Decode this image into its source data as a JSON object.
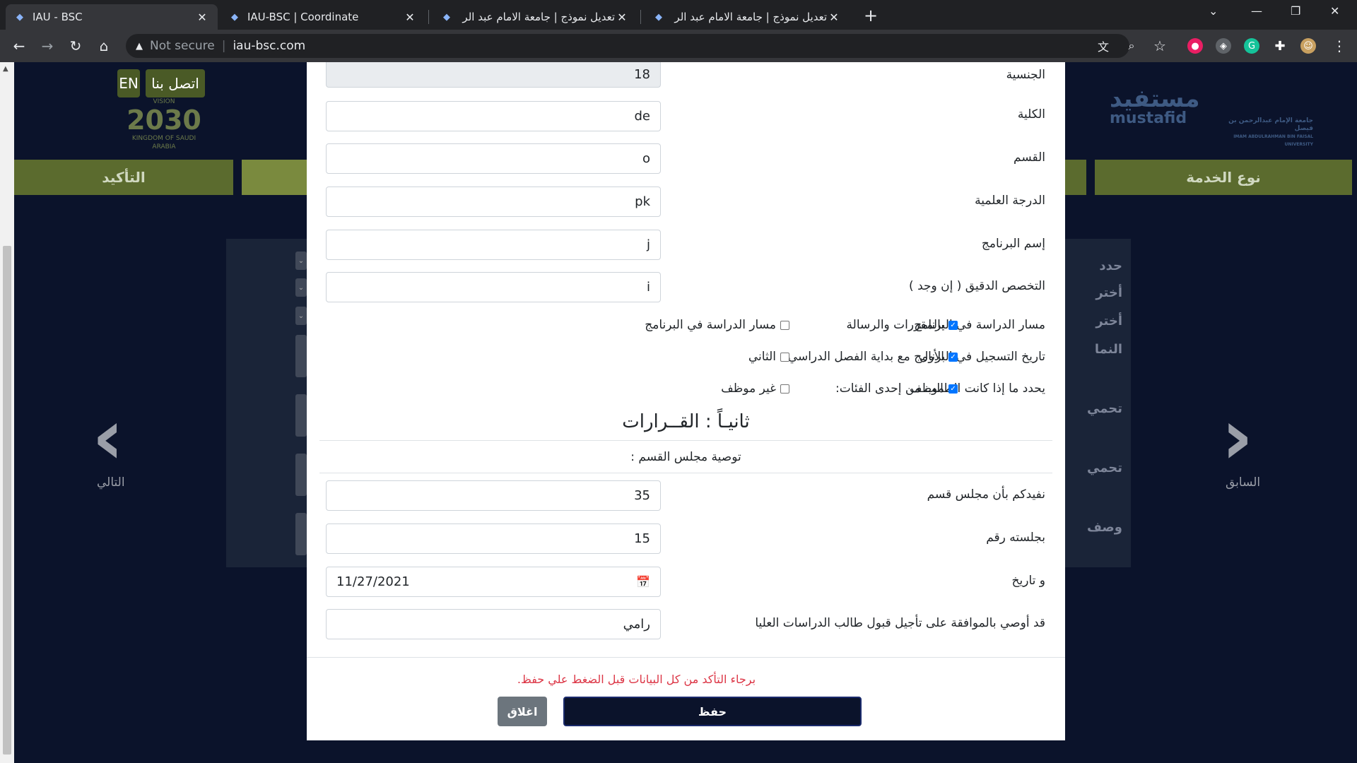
{
  "browser": {
    "tabs": [
      {
        "title": "IAU - BSC",
        "active": true
      },
      {
        "title": "IAU-BSC | Coordinate",
        "active": false
      },
      {
        "title": "تعديل نموذج | جامعة الامام عبد الر",
        "active": false
      },
      {
        "title": "تعديل نموذج | جامعة الامام عبد الر",
        "active": false
      }
    ],
    "address": {
      "security": "Not secure",
      "url": "iau-bsc.com"
    }
  },
  "background": {
    "contact_button": "اتصل بنا",
    "lang_button": "EN",
    "vision_text": "2030",
    "vision_label": "VISION",
    "vision_sub": "KINGDOM OF SAUDI ARABIA",
    "logo_mustafid": "مستفيد",
    "logo_mustafid_latin": "mustafid",
    "logo_university": "جامعة الإمام عبدالرحمن بن فيصل",
    "logo_university_en": "IMAM ABDULRAHMAN BIN FAISAL UNIVERSITY",
    "step_confirm": "التأكيد",
    "step_service_type": "نوع الخدمة",
    "panel_lines": [
      "حدد",
      "أختر",
      "أختر",
      "النما",
      "تحمي",
      "تحمي",
      "وصف"
    ],
    "next_label": "التالي",
    "prev_label": "السابق"
  },
  "modal": {
    "fields": [
      {
        "label": "الجنسية",
        "value": "18",
        "readonly": true
      },
      {
        "label": "الكلية",
        "value": "de"
      },
      {
        "label": "القسم",
        "value": "o"
      },
      {
        "label": "الدرجة العلمية",
        "value": "pk"
      },
      {
        "label": "إسم البرنامج",
        "value": "j"
      },
      {
        "label": "التخصص الدقيق ( إن وجد )",
        "value": "i"
      }
    ],
    "checks": [
      {
        "label": "مسار الدراسة في البرنامج",
        "opt1": "بالمقررات والرسالة",
        "opt1_checked": true,
        "opt2": "مسار الدراسة في البرنامج",
        "opt2_checked": false
      },
      {
        "label": "تاريخ التسجيل في البرنامج مع بداية الفصل الدراسي",
        "opt1": "الأول",
        "opt1_checked": true,
        "opt2": "الثاني",
        "opt2_checked": false
      },
      {
        "label": "يحدد ما إذا كانت الطالب من إحدى الفئات:",
        "opt1": "موظف",
        "opt1_checked": true,
        "opt2": "غير موظف",
        "opt2_checked": false
      }
    ],
    "section_title": "ثانيـاً : القــرارات",
    "subsection_title": "توصية مجلس القسم :",
    "decision_fields": [
      {
        "label": "نفيدكم بأن مجلس قسم",
        "value": "35"
      },
      {
        "label": "بجلسته رقم",
        "value": "15"
      },
      {
        "label": "و تاريخ",
        "value": "11/27/2021",
        "type": "date"
      },
      {
        "label": "قد أوصي بالموافقة على تأجيل قبول طالب الدراسات العليا",
        "value": "رامي"
      }
    ],
    "notice": "برجاء التأكد من كل البيانات قبل الضغط علي حفظ.",
    "save_label": "حفظ",
    "close_label": "اغلاق"
  }
}
